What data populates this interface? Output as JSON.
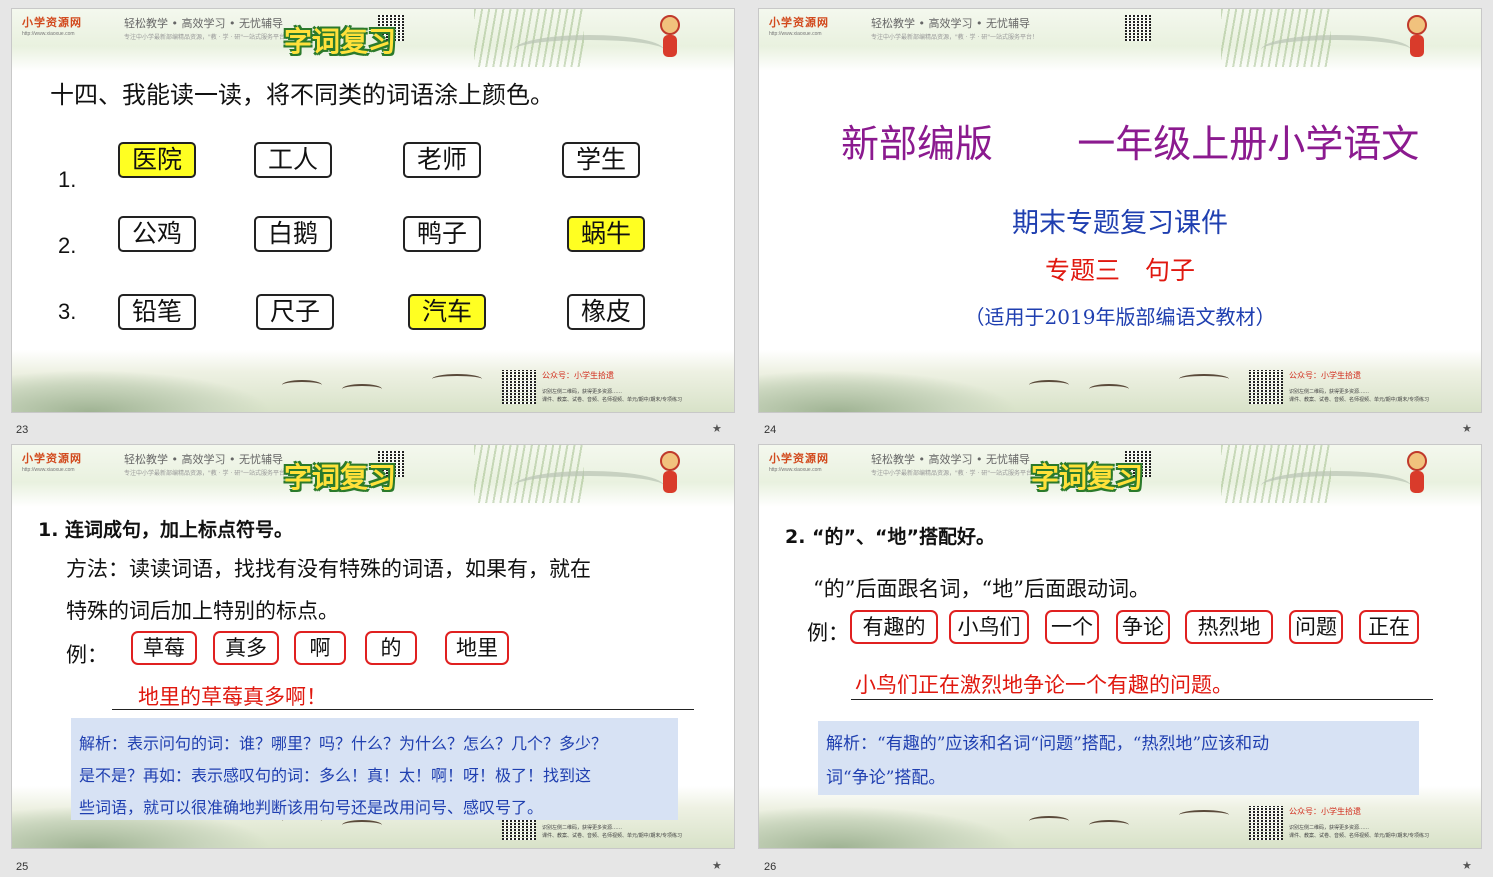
{
  "header": {
    "site_name": "小学资源网",
    "site_url": "http://www.xiaoxue.com",
    "slogan": "轻松教学 • 高效学习 • 无忧辅导",
    "sub_slogan": "专注中小学最新部编精品资源，\"教 · 学 · 研\"一站式服务平台！",
    "title": "字词复习"
  },
  "footer": {
    "account": "公众号：小学生拾遗",
    "line1": "识别左侧二维码，获得更多资源……",
    "line2": "课件、教案、试卷、音频、名师视频、单元/期中/期末/专项练习"
  },
  "slides": {
    "s23": {
      "number": "23",
      "heading": "十四、我能读一读，将不同类的词语涂上颜色。",
      "rows": [
        {
          "label": "1.",
          "words": [
            "医院",
            "工人",
            "老师",
            "学生"
          ],
          "highlight": 0
        },
        {
          "label": "2.",
          "words": [
            "公鸡",
            "白鹅",
            "鸭子",
            "蜗牛"
          ],
          "highlight": 3
        },
        {
          "label": "3.",
          "words": [
            "铅笔",
            "尺子",
            "汽车",
            "橡皮"
          ],
          "highlight": 2
        }
      ]
    },
    "s24": {
      "number": "24",
      "title_left": "新部编版",
      "title_right": "一年级上册小学语文",
      "subtitle": "期末专题复习课件",
      "topic": "专题三　句子",
      "note": "（适用于2019年版部编语文教材）"
    },
    "s25": {
      "number": "25",
      "heading": "1. 连词成句，加上标点符号。",
      "method_line1": "方法：读读词语，找找有没有特殊的词语，如果有，就在",
      "method_line2": "特殊的词后加上特别的标点。",
      "example_label": "例：",
      "words": [
        "草莓",
        "真多",
        "啊",
        "的",
        "地里"
      ],
      "answer": "地里的草莓真多啊！",
      "analysis_line1": "解析：表示问句的词：谁？哪里？吗？什么？为什么？怎么？几个？多少？",
      "analysis_line2": "是不是？再如：表示感叹句的词：多么！真！太！啊！呀！极了！找到这",
      "analysis_line3": "些词语，就可以很准确地判断该用句号还是改用问号、感叹号了。"
    },
    "s26": {
      "number": "26",
      "heading": "2. “的”、“地”搭配好。",
      "rule": "“的”后面跟名词，“地”后面跟动词。",
      "example_label": "例：",
      "words": [
        "有趣的",
        "小鸟们",
        "一个",
        "争论",
        "热烈地",
        "问题",
        "正在"
      ],
      "answer": "小鸟们正在激烈地争论一个有趣的问题。",
      "analysis_line1": "解析：“有趣的”应该和名词“问题”搭配，“热烈地”应该和动",
      "analysis_line2": "词“争论”搭配。"
    }
  },
  "colors": {
    "highlight": "#ffff22",
    "answer_red": "#e0180f",
    "title_purple": "#8b1a8f",
    "subtitle_blue": "#1f3fb0",
    "topic_red": "#e0180f"
  },
  "icons": [
    "monkey-icon",
    "bird-icon",
    "qr-code",
    "star-icon"
  ]
}
